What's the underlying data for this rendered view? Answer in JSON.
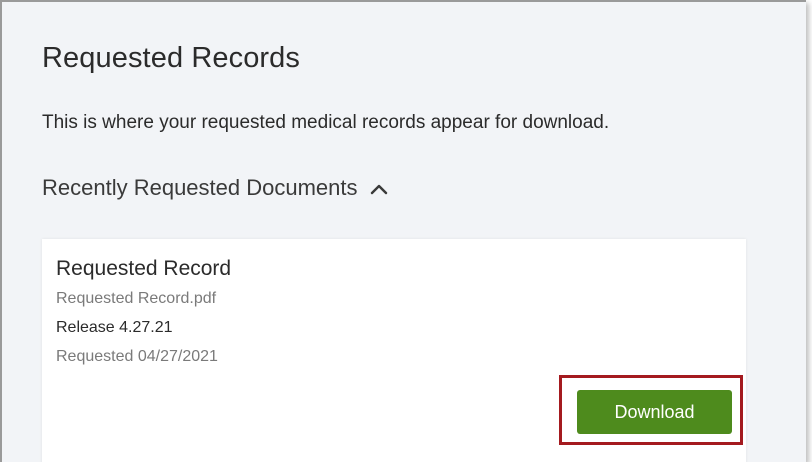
{
  "page": {
    "title": "Requested Records",
    "description": "This is where your requested medical records appear for download."
  },
  "section": {
    "title": "Recently Requested Documents",
    "expanded": true,
    "toggle_icon": "chevron-up-icon"
  },
  "record": {
    "title": "Requested Record",
    "filename": "Requested Record.pdf",
    "release": "Release 4.27.21",
    "requested_date": "Requested 04/27/2021",
    "download_label": "Download"
  },
  "colors": {
    "button_bg": "#4e8b1d",
    "highlight_border": "#a41a1f",
    "page_bg": "#f2f4f7"
  }
}
